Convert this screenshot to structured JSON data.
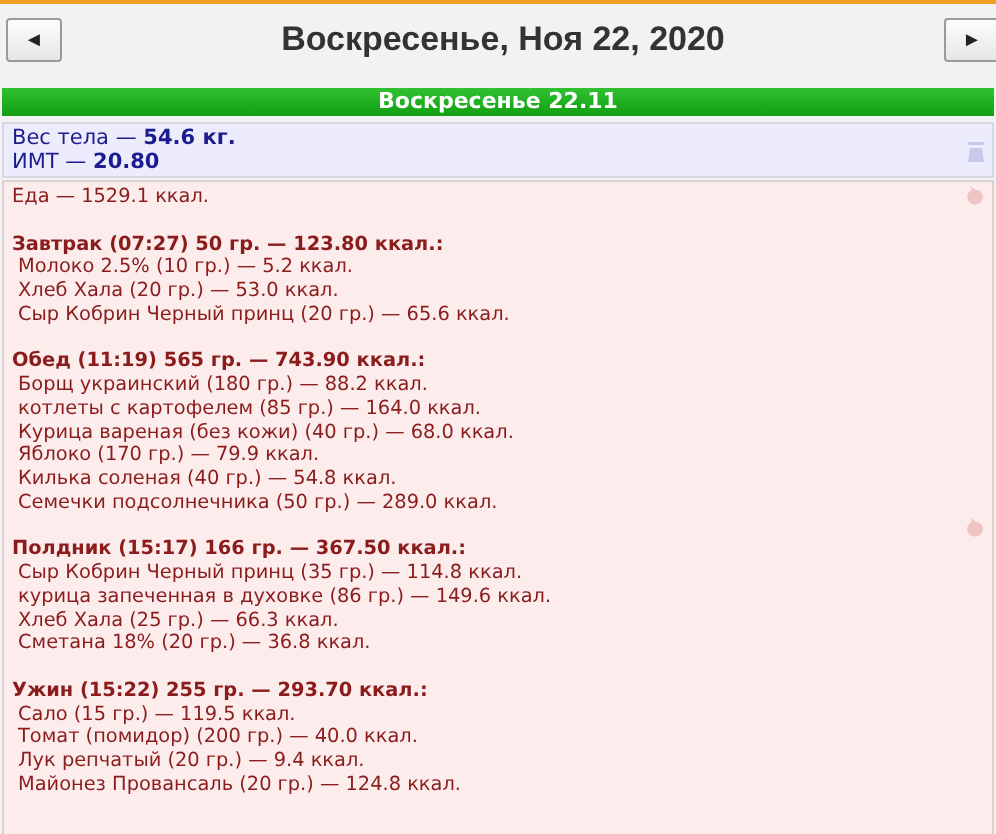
{
  "header": {
    "title": "Воскресенье, Ноя 22, 2020",
    "prev": "◄",
    "next": "►"
  },
  "day_bar": "Воскресенье 22.11",
  "body": {
    "lines": [
      "Вес тела — **54.6 кг.**",
      "ИМТ — **20.80**"
    ]
  },
  "food": {
    "total": "Еда — 1529.1 ккал.",
    "meals": [
      {
        "title": "Завтрак (07:27) 50 гр. — 123.80 ккал.:",
        "icon": false,
        "items": [
          "Молоко 2.5% (10 гр.) — 5.2 ккал.",
          "Хлеб Хала (20 гр.) — 53.0 ккал.",
          "Сыр Кобрин Черный принц (20 гр.) — 65.6 ккал."
        ]
      },
      {
        "title": "Обед (11:19) 565 гр. — 743.90 ккал.:",
        "icon": false,
        "items": [
          "Борщ украинский (180 гр.) — 88.2 ккал.",
          "котлеты с картофелем (85 гр.) — 164.0 ккал.",
          "Курица вареная (без кожи) (40 гр.) — 68.0 ккал.",
          "Яблоко (170 гр.) — 79.9 ккал.",
          "Килька соленая (40 гр.) — 54.8 ккал.",
          "Семечки подсолнечника (50 гр.) — 289.0 ккал."
        ]
      },
      {
        "title": "Полдник (15:17) 166 гр. — 367.50 ккал.:",
        "icon": true,
        "items": [
          "Сыр Кобрин Черный принц (35 гр.) — 114.8 ккал.",
          "курица запеченная в духовке (86 гр.) — 149.6 ккал.",
          "Хлеб Хала (25 гр.) — 66.3 ккал.",
          "Сметана 18% (20 гр.) — 36.8 ккал."
        ]
      },
      {
        "title": "Ужин (15:22) 255 гр. — 293.70 ккал.:",
        "icon": false,
        "items": [
          "Сало (15 гр.) — 119.5 ккал.",
          "Томат (помидор) (200 гр.) — 40.0 ккал.",
          "Лук репчатый (20 гр.) — 9.4 ккал.",
          "Майонез Провансаль (20 гр.) — 124.8 ккал."
        ]
      }
    ]
  }
}
